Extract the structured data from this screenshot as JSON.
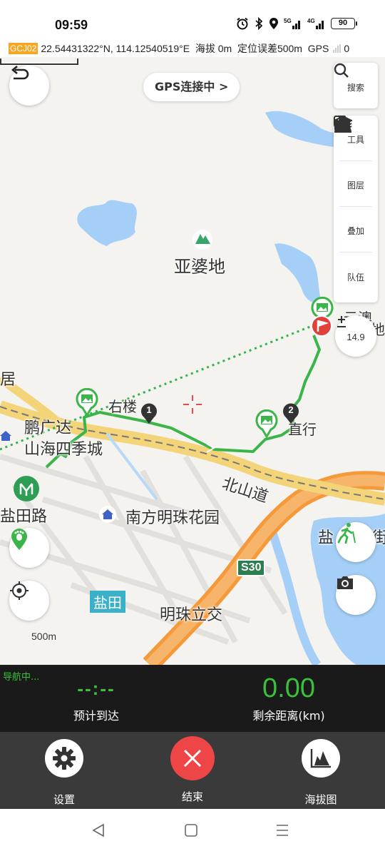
{
  "status_bar": {
    "time": "09:59",
    "battery": "90"
  },
  "coord_bar": {
    "crs": "GCJ02",
    "lat": "22.54431322°N",
    "lon": "114.12540519°E",
    "altitude": "海拔 0m",
    "accuracy": "定位误差500m",
    "gps_label": "GPS",
    "gps_count": "0"
  },
  "map": {
    "gps_status": "GPS连接中 >",
    "side_panel": {
      "search": "搜索",
      "tools": "工具",
      "layers": "图层",
      "overlay": "叠加",
      "team": "队伍"
    },
    "zoom_level": "14.9",
    "scale": "500m",
    "waypoint_1": "1",
    "waypoint_2": "2",
    "labels": {
      "yapodi": "亚婆地",
      "youlou": "右楼",
      "zhixing": "直行",
      "penggudi": "鹏广达",
      "shanhai": "山海四季城",
      "beishandao": "北山道",
      "yantian_road": "盐田路",
      "nanfang": "南方明珠花园",
      "s30": "S30",
      "yantian": "盐田",
      "mingzhu": "明珠立交",
      "ju": "居",
      "yan_right": "盐",
      "jie": "街",
      "yun_top": "云澳",
      "di_top": "地"
    }
  },
  "nav_panel": {
    "status": "导航中...",
    "eta_value": "--:--",
    "eta_label": "预计到达",
    "distance_value": "0.00",
    "distance_label": "剩余距离(km)"
  },
  "action_bar": {
    "settings": "设置",
    "end": "结束",
    "elevation": "海拔图"
  }
}
